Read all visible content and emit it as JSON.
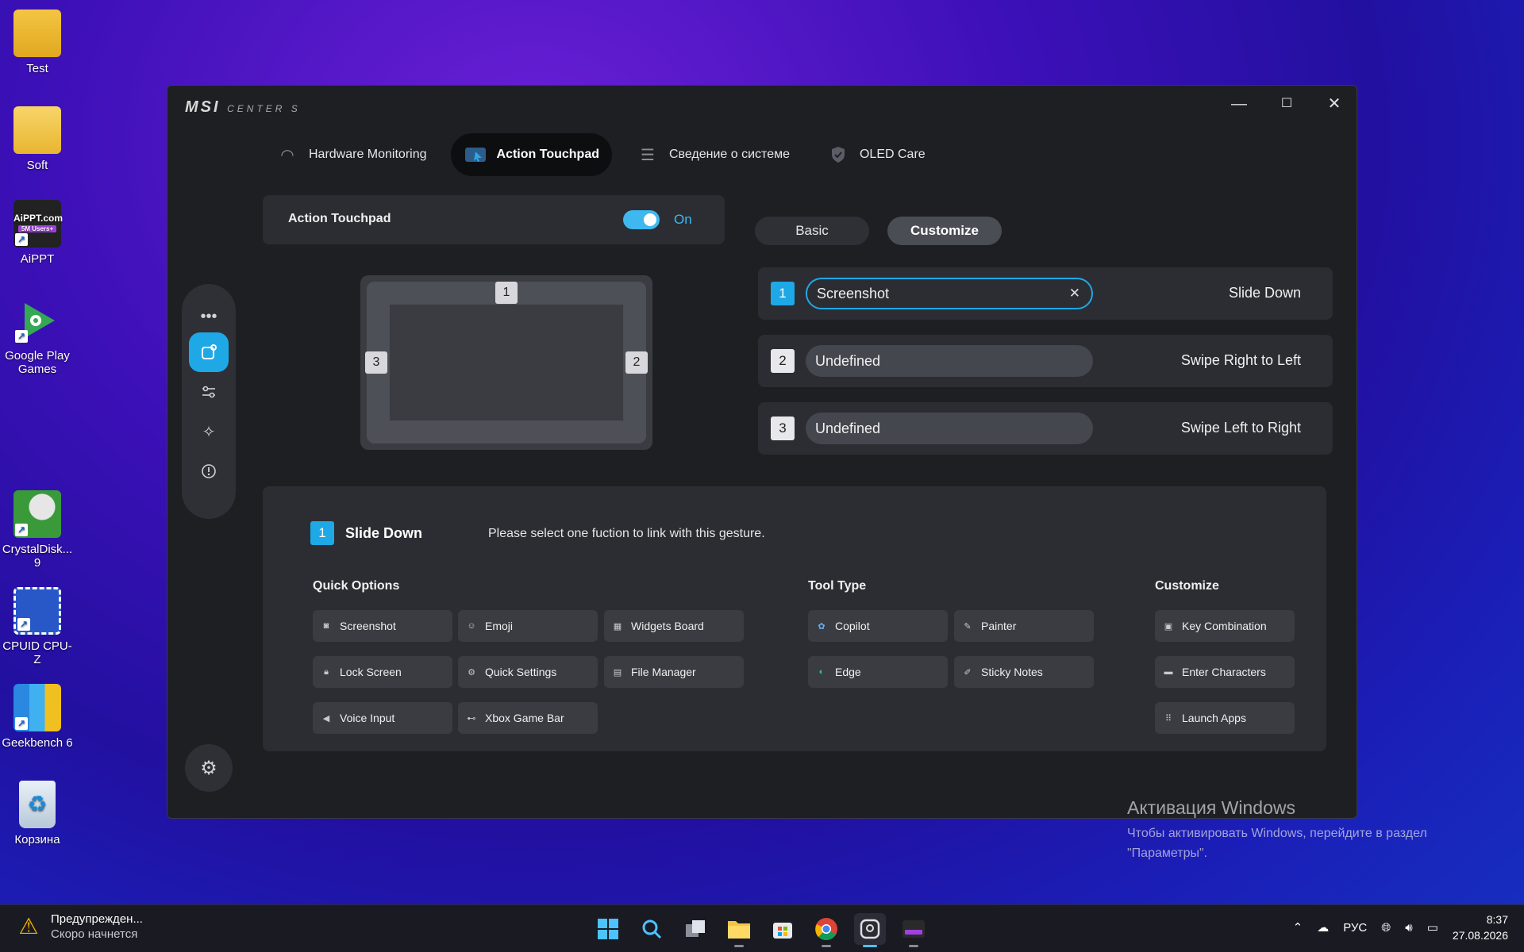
{
  "desktop": {
    "icons": [
      {
        "label": "Test"
      },
      {
        "label": "Soft"
      },
      {
        "label": "AiPPT"
      },
      {
        "label": "Google Play Games"
      },
      {
        "label": "CrystalDisk... 9"
      },
      {
        "label": "CPUID CPU-Z"
      },
      {
        "label": "Geekbench 6"
      },
      {
        "label": "Корзина"
      }
    ],
    "aippt_badge": "AiPPT.com",
    "aippt_sub": "5M Users+"
  },
  "window": {
    "logo": "MSI",
    "logo_sub": "CENTER S",
    "controls": {
      "minimize": "—",
      "maximize": "☐",
      "close": "✕"
    }
  },
  "tabs": [
    {
      "label": "Hardware Monitoring",
      "icon": "speedometer-icon"
    },
    {
      "label": "Action Touchpad",
      "icon": "touchpad-icon",
      "active": true
    },
    {
      "label": "Сведение о системе",
      "icon": "system-info-icon"
    },
    {
      "label": "OLED Care",
      "icon": "shield-icon"
    }
  ],
  "toggle": {
    "label": "Action Touchpad",
    "state": "On",
    "on": true
  },
  "mode": {
    "basic": "Basic",
    "customize": "Customize",
    "active": "Customize"
  },
  "touchpad": {
    "zones": [
      "1",
      "2",
      "3"
    ]
  },
  "gestures": [
    {
      "num": "1",
      "value": "Screenshot",
      "name": "Slide Down",
      "selected": true
    },
    {
      "num": "2",
      "value": "Undefined",
      "name": "Swipe Right to Left",
      "selected": false
    },
    {
      "num": "3",
      "value": "Undefined",
      "name": "Swipe Left to Right",
      "selected": false
    }
  ],
  "panel": {
    "num": "1",
    "title": "Slide Down",
    "hint": "Please select one fuction to link with this gesture.",
    "sections": {
      "quick": "Quick Options",
      "tool": "Tool Type",
      "custom": "Customize"
    },
    "quick_options": [
      {
        "label": "Screenshot",
        "icon": "camera-icon"
      },
      {
        "label": "Emoji",
        "icon": "emoji-icon"
      },
      {
        "label": "Widgets Board",
        "icon": "widgets-icon"
      },
      {
        "label": "Lock Screen",
        "icon": "lock-icon"
      },
      {
        "label": "Quick Settings",
        "icon": "gear-icon"
      },
      {
        "label": "File Manager",
        "icon": "file-icon"
      },
      {
        "label": "Voice Input",
        "icon": "speaker-icon"
      },
      {
        "label": "Xbox Game Bar",
        "icon": "gamepad-icon"
      }
    ],
    "tool_type": [
      {
        "label": "Copilot",
        "icon": "copilot-icon"
      },
      {
        "label": "Painter",
        "icon": "brush-icon"
      },
      {
        "label": "Edge",
        "icon": "edge-icon"
      },
      {
        "label": "Sticky Notes",
        "icon": "note-icon"
      }
    ],
    "customize": [
      {
        "label": "Key Combination",
        "icon": "key-icon"
      },
      {
        "label": "Enter Characters",
        "icon": "keyboard-icon"
      },
      {
        "label": "Launch Apps",
        "icon": "apps-grid-icon"
      }
    ]
  },
  "activation": {
    "title": "Активация Windows",
    "text": "Чтобы активировать Windows, перейдите в раздел \"Параметры\"."
  },
  "taskbar": {
    "notice_title": "Предупрежден...",
    "notice_sub": "Скоро начнется",
    "lang": "РУС",
    "time": "8:37",
    "date": "27.08.2026"
  }
}
